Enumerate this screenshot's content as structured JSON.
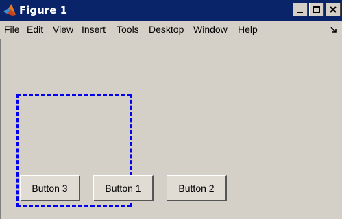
{
  "window": {
    "title": "Figure 1",
    "controls": {
      "minimize": "minimize-icon",
      "maximize": "maximize-icon",
      "close": "close-icon"
    }
  },
  "menubar": {
    "items": [
      "File",
      "Edit",
      "View",
      "Insert",
      "Tools",
      "Desktop",
      "Window",
      "Help"
    ],
    "overflow_icon": "dock-arrow-icon"
  },
  "uipanel": {
    "border_color": "#0000ee",
    "border_style": "dashed"
  },
  "buttons": [
    {
      "label": "Button 3"
    },
    {
      "label": "Button 1"
    },
    {
      "label": "Button 2"
    }
  ],
  "colors": {
    "titlebar": "#0a246a",
    "background": "#d4d0c8"
  }
}
